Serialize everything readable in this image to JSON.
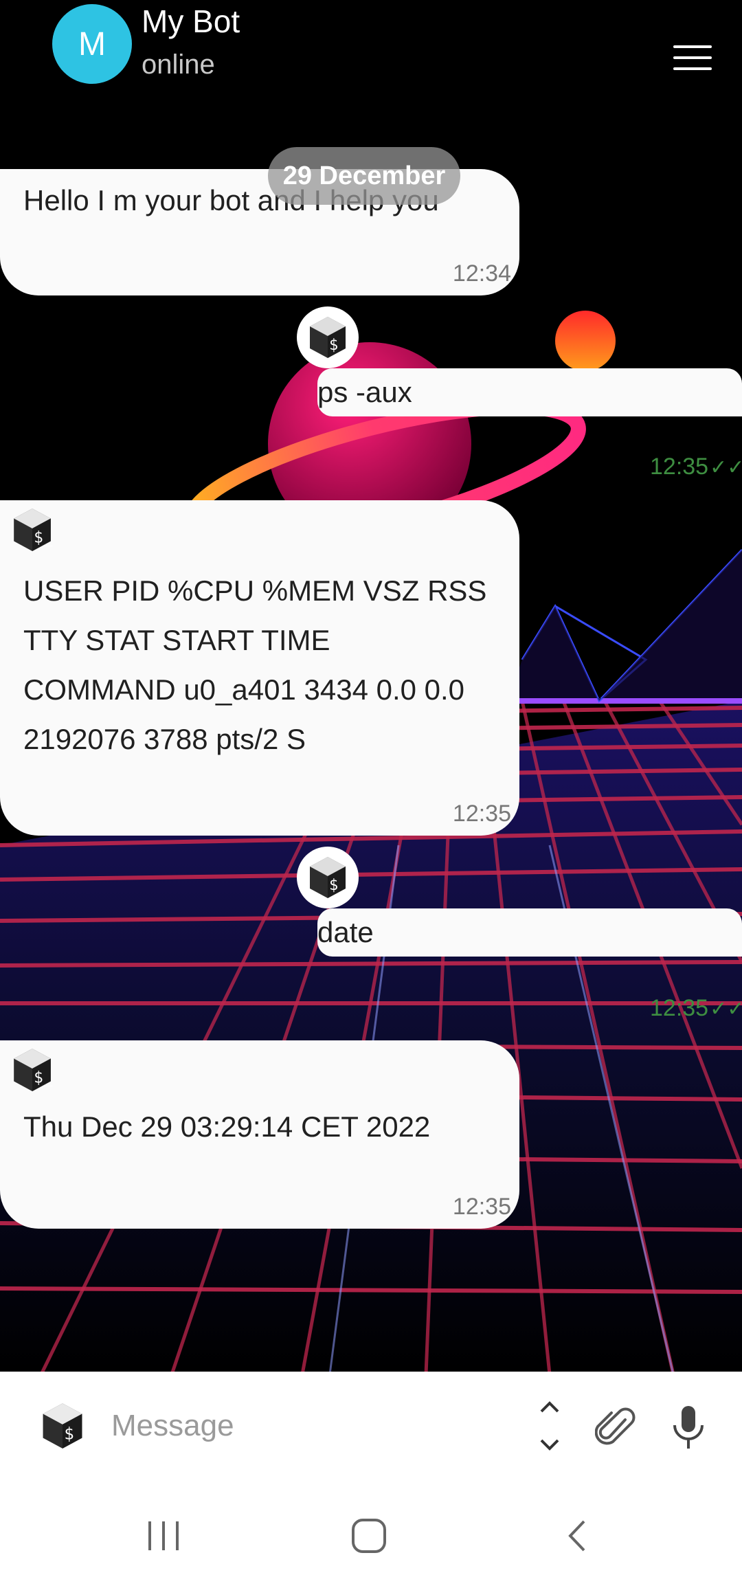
{
  "header": {
    "avatar_letter": "M",
    "name": "My Bot",
    "status": "online"
  },
  "date_separator": "29 December",
  "messages": [
    {
      "direction": "in",
      "text": "Hello I m your bot and I help you",
      "time": "12:34"
    },
    {
      "direction": "out",
      "text": "ps -aux",
      "time": "12:35"
    },
    {
      "direction": "in",
      "lines": [
        "USER PID %CPU %MEM VSZ RSS",
        "TTY STAT START TIME",
        "COMMAND u0_a401 3434 0.0 0.0",
        "2192076 3788 pts/2 S"
      ],
      "time": "12:35"
    },
    {
      "direction": "out",
      "text": "date",
      "time": "12:35"
    },
    {
      "direction": "in",
      "text": "Thu Dec 29 03:29:14 CET 2022",
      "time": "12:35"
    }
  ],
  "composer": {
    "placeholder": "Message"
  },
  "icons": [
    "bash-icon",
    "menu-icon",
    "expand-collapse-icon",
    "attach-icon",
    "mic-icon",
    "recent-apps-icon",
    "home-icon",
    "back-icon"
  ],
  "colors": {
    "avatar": "#2ec3e3",
    "sent_time": "#3e8e41"
  }
}
